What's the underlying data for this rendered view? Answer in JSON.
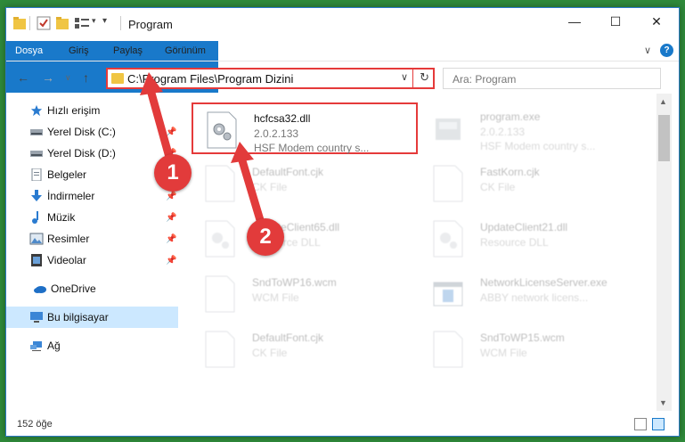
{
  "window": {
    "title": "Program",
    "min_glyph": "—",
    "max_glyph": "☐",
    "close_glyph": "✕"
  },
  "ribbon": {
    "tabs": [
      "Dosya",
      "Giriş",
      "Paylaş",
      "Görünüm"
    ],
    "collapse_glyph": "∨",
    "help_glyph": "?"
  },
  "nav": {
    "back_glyph": "←",
    "forward_glyph": "→",
    "recent_glyph": "∨",
    "up_glyph": "↑",
    "address": "C:\\Program Files\\Program Dizini",
    "address_chevron": "∨",
    "refresh_glyph": "↻",
    "search_placeholder": "Ara: Program"
  },
  "sidebar": {
    "items": [
      {
        "label": "Hızlı erişim",
        "icon": "star-icon",
        "pinned": false
      },
      {
        "label": "Yerel Disk (C:)",
        "icon": "drive-icon",
        "pinned": true
      },
      {
        "label": "Yerel Disk (D:)",
        "icon": "drive-icon",
        "pinned": true
      },
      {
        "label": "Belgeler",
        "icon": "document-icon",
        "pinned": true
      },
      {
        "label": "İndirmeler",
        "icon": "download-icon",
        "pinned": true
      },
      {
        "label": "Müzik",
        "icon": "music-icon",
        "pinned": true
      },
      {
        "label": "Resimler",
        "icon": "pictures-icon",
        "pinned": true
      },
      {
        "label": "Videolar",
        "icon": "video-icon",
        "pinned": true
      },
      {
        "label": "OneDrive",
        "icon": "onedrive-icon",
        "pinned": false
      },
      {
        "label": "Bu bilgisayar",
        "icon": "computer-icon",
        "pinned": false,
        "selected": true
      },
      {
        "label": "Ağ",
        "icon": "network-icon",
        "pinned": false
      }
    ],
    "pin_glyph": "📌"
  },
  "files": [
    {
      "name": "hcfcsa32.dll",
      "line2": "2.0.2.133",
      "line3": "HSF Modem country s...",
      "icon": "dll-gear-icon",
      "highlighted": true
    },
    {
      "name": "program.exe",
      "line2": "2.0.2.133",
      "line3": "HSF Modem country s...",
      "icon": "exe-icon"
    },
    {
      "name": "DefaultFont.cjk",
      "line2": "CK File",
      "icon": "blank-file-icon"
    },
    {
      "name": "FastKorn.cjk",
      "line2": "CK File",
      "icon": "blank-file-icon"
    },
    {
      "name": "UpdateClient65.dll",
      "line2": "Resource DLL",
      "icon": "dll-gear-icon"
    },
    {
      "name": "UpdateClient21.dll",
      "line2": "Resource DLL",
      "icon": "dll-gear-icon"
    },
    {
      "name": "SndToWP16.wcm",
      "line2": "WCM File",
      "icon": "blank-file-icon"
    },
    {
      "name": "NetworkLicenseServer.exe",
      "line2": "ABBY network licens...",
      "icon": "window-icon"
    },
    {
      "name": "DefaultFont.cjk",
      "line2": "CK File",
      "icon": "blank-file-icon"
    },
    {
      "name": "SndToWP15.wcm",
      "line2": "WCM File",
      "icon": "blank-file-icon"
    }
  ],
  "status": {
    "count": "152 öğe"
  },
  "annotations": {
    "badge1": "1",
    "badge2": "2",
    "color": "#e23b3b"
  },
  "colors": {
    "accent": "#1979ca",
    "highlight": "#e53a3a",
    "selection": "#cce8ff"
  }
}
